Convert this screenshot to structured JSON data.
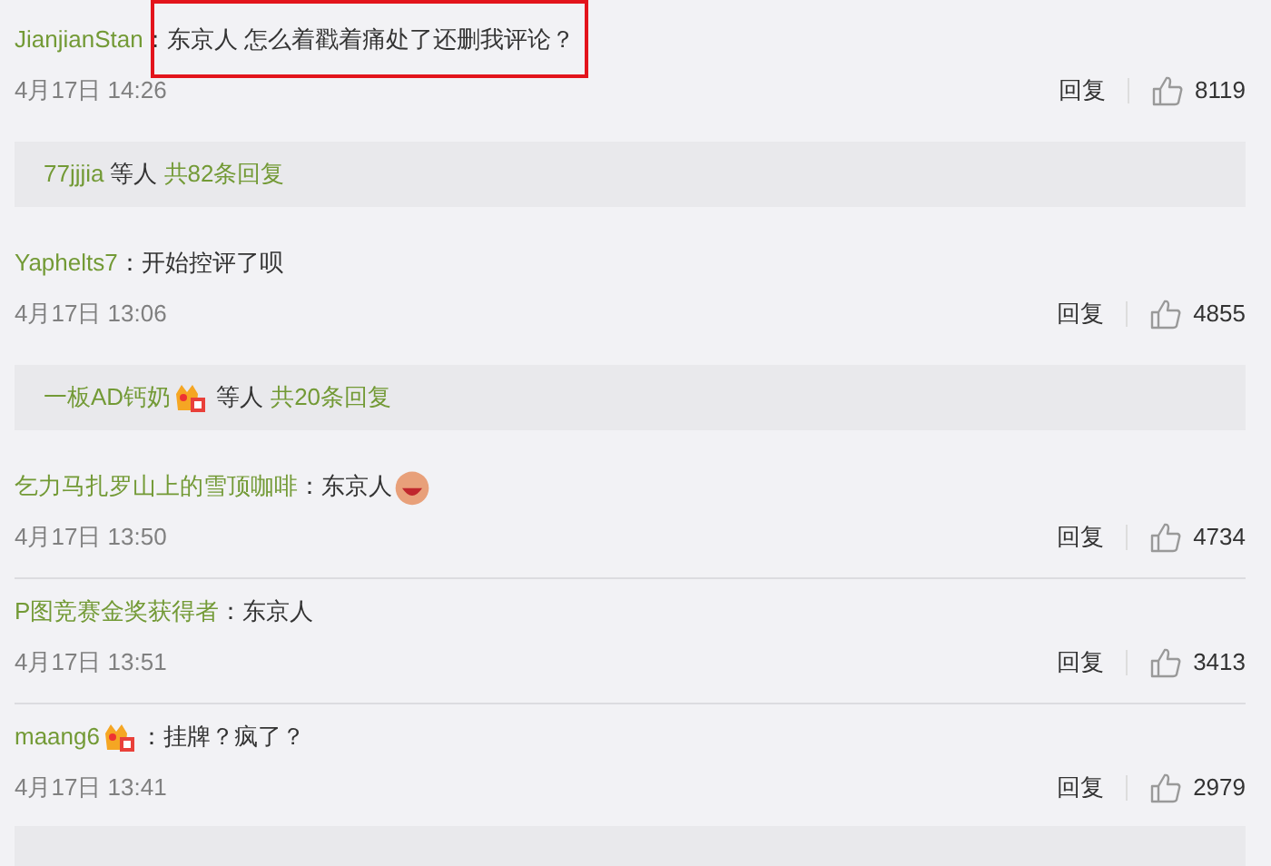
{
  "comments": [
    {
      "user": "JianjianStan",
      "separator": "：",
      "text": "东京人 怎么着戳着痛处了还删我评论？",
      "highlighted": true,
      "time": "4月17日 14:26",
      "reply_label": "回复",
      "likes": "8119",
      "reply_summary": {
        "users": "77jjjia",
        "others": "等人",
        "count": "共82条回复"
      }
    },
    {
      "user": "Yaphelts7",
      "separator": "：",
      "text": "开始控评了呗",
      "time": "4月17日 13:06",
      "reply_label": "回复",
      "likes": "4855",
      "reply_summary": {
        "users": "一板AD钙奶",
        "badge": true,
        "others": "等人",
        "count": "共20条回复"
      }
    },
    {
      "user": "乞力马扎罗山上的雪顶咖啡",
      "separator": "：",
      "text": "东京人",
      "emoji": true,
      "time": "4月17日 13:50",
      "reply_label": "回复",
      "likes": "4734"
    },
    {
      "user": "P图竞赛金奖获得者",
      "separator": "：",
      "text": "东京人",
      "time": "4月17日 13:51",
      "reply_label": "回复",
      "likes": "3413"
    },
    {
      "user": "maang6",
      "badge": true,
      "separator": "：",
      "text": "挂牌？疯了？",
      "time": "4月17日 13:41",
      "reply_label": "回复",
      "likes": "2979",
      "reply_summary": {
        "partial": true
      }
    }
  ]
}
